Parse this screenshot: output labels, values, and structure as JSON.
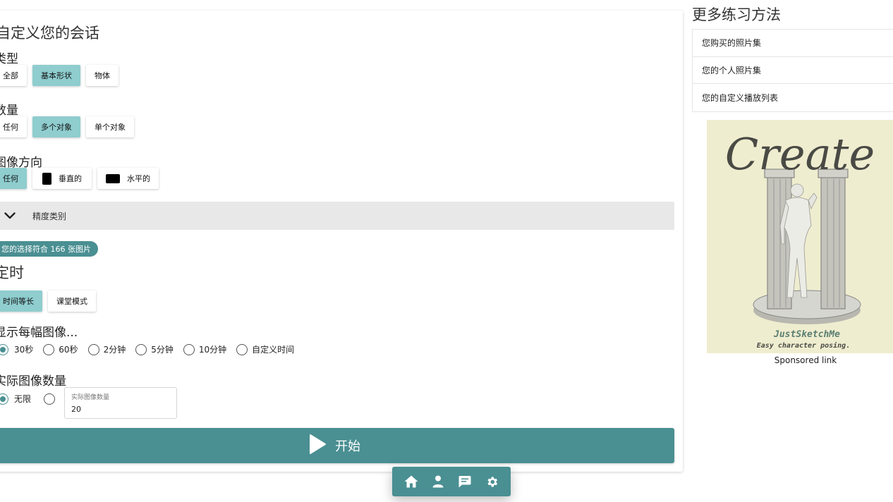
{
  "main": {
    "title": "自定义您的会话",
    "type_section": {
      "heading": "类型",
      "options": [
        "全部",
        "基本形状",
        "物体"
      ],
      "selected": "基本形状"
    },
    "count_section": {
      "heading": "数量",
      "options": [
        "任何",
        "多个对象",
        "单个对象"
      ],
      "selected": "多个对象"
    },
    "orientation_section": {
      "heading": "图像方向",
      "options": [
        "任何",
        "垂直的",
        "水平的"
      ],
      "selected": "任何"
    },
    "precision_accordion": "精度类别",
    "match_text": "您的选择符合 166 张图片",
    "timing_title": "定时",
    "timing_modes": [
      "时间等长",
      "课堂模式"
    ],
    "timing_selected": "时间等长",
    "show_each_heading": "显示每幅图像...",
    "durations": [
      "30秒",
      "60秒",
      "2分钟",
      "5分钟",
      "10分钟",
      "自定义时间"
    ],
    "duration_selected": "30秒",
    "image_count_heading": "实际图像数量",
    "image_count_options": [
      "无限"
    ],
    "image_count_field_label": "实际图像数量",
    "image_count_value": "20",
    "start_label": "开始"
  },
  "bottom_nav": [
    "home-icon",
    "person-icon",
    "feedback-icon",
    "gear-icon"
  ],
  "sidebar": {
    "title": "更多练习方法",
    "items": [
      "您购买的照片集",
      "您的个人照片集",
      "您的自定义播放列表"
    ],
    "ad": {
      "headline": "Create",
      "brand": "JustSketchMe",
      "tagline": "Easy character posing."
    },
    "sponsored_label": "Sponsored link"
  },
  "colors": {
    "accent": "#4a8f92",
    "selected_chip": "#8fcdcf",
    "accordion_bg": "#e8e8e8",
    "ad_bg": "#efedcf"
  }
}
